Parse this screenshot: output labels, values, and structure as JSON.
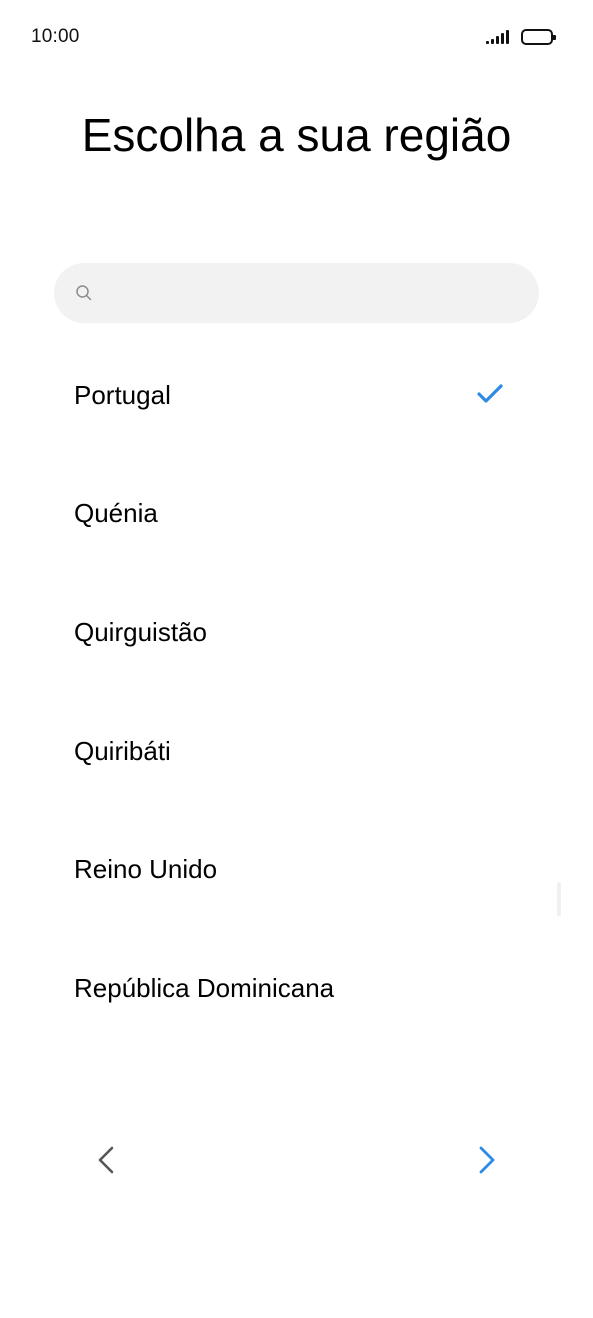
{
  "status_bar": {
    "time": "10:00",
    "icons": [
      "signal-icon",
      "battery-icon"
    ]
  },
  "page": {
    "title": "Escolha a sua região"
  },
  "search": {
    "value": "",
    "placeholder": "",
    "icon": "search-icon"
  },
  "regions": [
    {
      "label": "Portugal",
      "selected": true
    },
    {
      "label": "Quénia",
      "selected": false
    },
    {
      "label": "Quirguistão",
      "selected": false
    },
    {
      "label": "Quiribáti",
      "selected": false
    },
    {
      "label": "Reino Unido",
      "selected": false
    },
    {
      "label": "República Dominicana",
      "selected": false
    }
  ],
  "navigation": {
    "back_icon": "chevron-left-icon",
    "next_icon": "chevron-right-icon"
  },
  "colors": {
    "accent": "#2e8ae6",
    "back_chevron": "#555555",
    "search_bg": "#f2f2f2",
    "text": "#000000"
  }
}
